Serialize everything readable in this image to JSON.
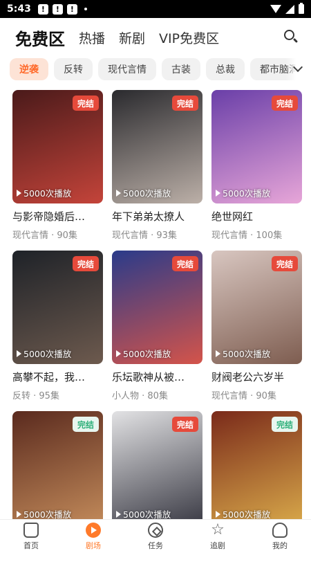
{
  "status": {
    "time": "5:43",
    "notif_icons": [
      "!",
      "!",
      "!"
    ]
  },
  "topnav": {
    "tabs": [
      {
        "label": "免费区",
        "active": true
      },
      {
        "label": "热播",
        "active": false
      },
      {
        "label": "新剧",
        "active": false
      },
      {
        "label": "VIP免费区",
        "active": false
      }
    ]
  },
  "chips": [
    {
      "label": "逆袭",
      "active": true
    },
    {
      "label": "反转",
      "active": false
    },
    {
      "label": "现代言情",
      "active": false
    },
    {
      "label": "古装",
      "active": false
    },
    {
      "label": "总裁",
      "active": false
    },
    {
      "label": "都市脑洞",
      "active": false
    }
  ],
  "dramas": [
    {
      "title": "与影帝隐婚后…",
      "meta": "现代言情 · 90集",
      "plays": "5000次播放",
      "badge": "完结",
      "badge_style": "red",
      "colors": [
        "#4a1a1a",
        "#c4443a"
      ]
    },
    {
      "title": "年下弟弟太撩人",
      "meta": "现代言情 · 93集",
      "plays": "5000次播放",
      "badge": "完结",
      "badge_style": "red",
      "colors": [
        "#2a2a2e",
        "#bcb0a8"
      ]
    },
    {
      "title": "绝世网红",
      "meta": "现代言情 · 100集",
      "plays": "5000次播放",
      "badge": "完结",
      "badge_style": "red",
      "colors": [
        "#6a3fa8",
        "#e7a6d8"
      ]
    },
    {
      "title": "高攀不起，我…",
      "meta": "反转 · 95集",
      "plays": "5000次播放",
      "badge": "完结",
      "badge_style": "red",
      "colors": [
        "#1e2228",
        "#6d5a4e"
      ]
    },
    {
      "title": "乐坛歌神从被…",
      "meta": "小人物 · 80集",
      "plays": "5000次播放",
      "badge": "完结",
      "badge_style": "red",
      "colors": [
        "#2a3b8a",
        "#d4544a"
      ]
    },
    {
      "title": "财阀老公六岁半",
      "meta": "现代言情 · 90集",
      "plays": "5000次播放",
      "badge": "完结",
      "badge_style": "red",
      "colors": [
        "#d8c6c0",
        "#7e5d50"
      ]
    },
    {
      "title": "",
      "meta": "",
      "plays": "5000次播放",
      "badge": "完结",
      "badge_style": "green",
      "colors": [
        "#5a2a1e",
        "#c28a5a"
      ]
    },
    {
      "title": "",
      "meta": "",
      "plays": "5000次播放",
      "badge": "完结",
      "badge_style": "red",
      "colors": [
        "#e2e2e4",
        "#3a3a44"
      ]
    },
    {
      "title": "",
      "meta": "",
      "plays": "5000次播放",
      "badge": "完结",
      "badge_style": "green",
      "colors": [
        "#7a2a1a",
        "#d8a84a"
      ]
    }
  ],
  "bottom_nav": [
    {
      "label": "首页",
      "icon": "home-icon",
      "active": false
    },
    {
      "label": "剧场",
      "icon": "theater-icon",
      "active": true
    },
    {
      "label": "任务",
      "icon": "task-icon",
      "active": false
    },
    {
      "label": "追剧",
      "icon": "follow-icon",
      "active": false
    },
    {
      "label": "我的",
      "icon": "profile-icon",
      "active": false
    }
  ]
}
